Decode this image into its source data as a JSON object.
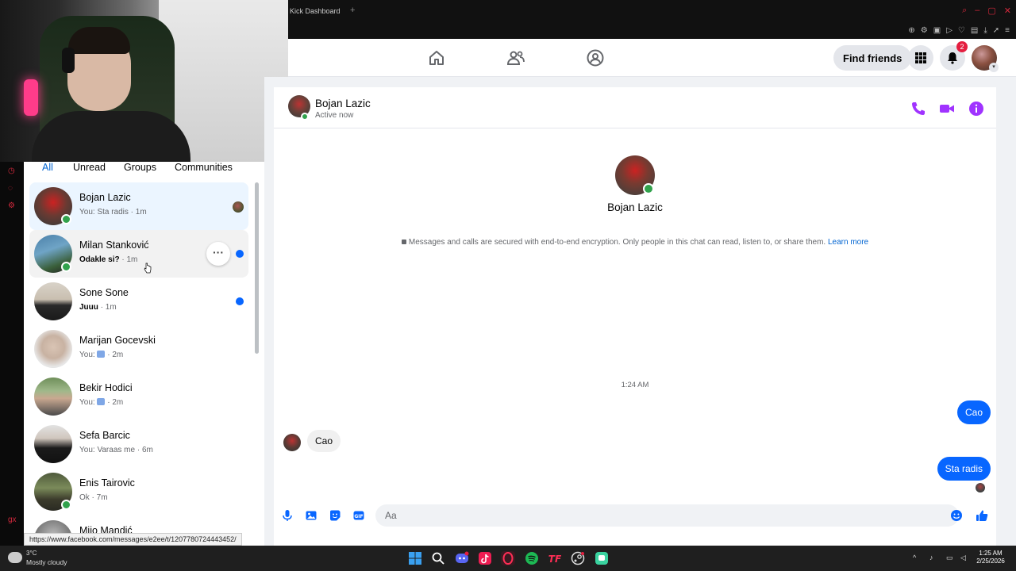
{
  "browser": {
    "tab_title": "Kick Dashboard",
    "new_tab": "+",
    "status_url": "https://www.facebook.com/messages/e2ee/t/1207780724443452/"
  },
  "nav": {
    "find_friends_label": "Find friends",
    "notification_count": "2"
  },
  "filters": [
    "All",
    "Unread",
    "Groups",
    "Communities"
  ],
  "chats": [
    {
      "name": "Bojan Lazic",
      "prefix": "You: ",
      "preview": "Sta radis",
      "time": " · 1m"
    },
    {
      "name": "Milan Stanković",
      "prefix": "",
      "preview": "Odakle si?",
      "time": " · 1m"
    },
    {
      "name": "Sone Sone",
      "prefix": "",
      "preview": "Juuu",
      "time": " · 1m"
    },
    {
      "name": "Marijan Gocevski",
      "prefix": "You: ",
      "preview": "",
      "time": " · 2m"
    },
    {
      "name": "Bekir Hodici",
      "prefix": "You: ",
      "preview": "",
      "time": " · 2m"
    },
    {
      "name": "Sefa Barcic",
      "prefix": "You: ",
      "preview": "Varaas me",
      "time": " · 6m"
    },
    {
      "name": "Enis Tairovic",
      "prefix": "",
      "preview": "Ok",
      "time": " · 7m"
    },
    {
      "name": "Mijo Mandić",
      "prefix": "",
      "preview": "",
      "time": ""
    }
  ],
  "conversation": {
    "name": "Bojan Lazic",
    "status": "Active now",
    "e2ee_text": "Messages and calls are secured with end-to-end encryption. Only people in this chat can read, listen to, or share them.",
    "learn_more": "Learn more",
    "timestamp": "1:24 AM",
    "messages": [
      {
        "from": "me",
        "text": "Cao"
      },
      {
        "from": "them",
        "text": "Cao"
      },
      {
        "from": "me",
        "text": "Sta radis"
      }
    ],
    "input_placeholder": "Aa"
  },
  "taskbar": {
    "temperature": "3°C",
    "weather": "Mostly cloudy",
    "time": "1:25 AM",
    "date": "2/25/2026"
  },
  "colors": {
    "accent": "#0866ff",
    "messenger_purple": "#a033ff",
    "online": "#31a24c"
  }
}
